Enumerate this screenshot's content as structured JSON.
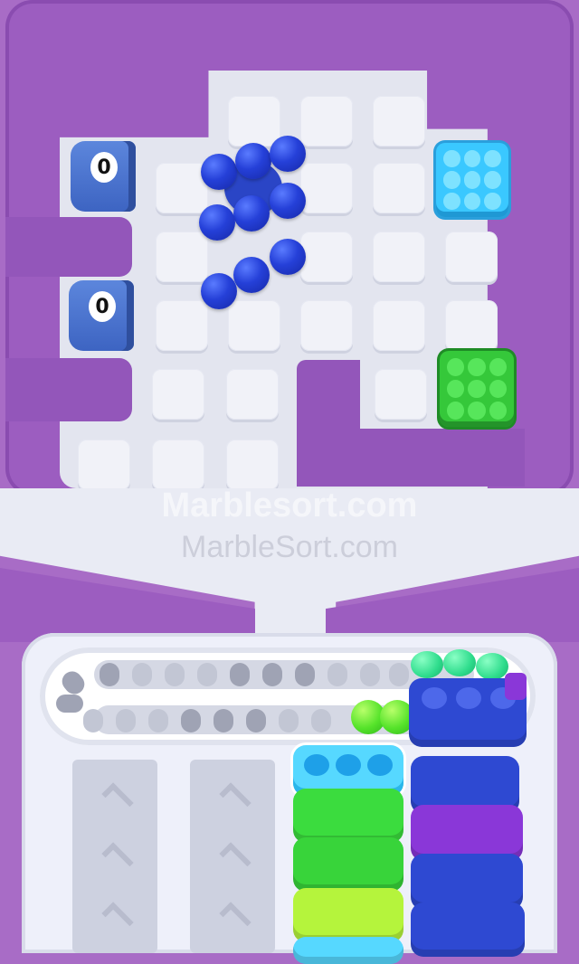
{
  "game": {
    "watermark_primary": "Marblesort.com",
    "watermark_secondary": "MarbleSort.com",
    "cannons": [
      {
        "count": "0",
        "color": "#4a72d0"
      },
      {
        "count": "0",
        "color": "#4a72d0"
      }
    ],
    "crates": [
      {
        "color": "cyan",
        "marbles": 9
      },
      {
        "color": "green",
        "marbles": 9
      }
    ],
    "bins_left": [
      "cyan",
      "green",
      "green",
      "lime",
      "cyan"
    ],
    "bins_right": [
      "blue",
      "blue",
      "purple",
      "blue",
      "blue"
    ],
    "colors": {
      "background": "#a86cc6",
      "marble_blue": "#2540d8",
      "crate_cyan": "#3ac8ff",
      "crate_green": "#35c83a"
    }
  }
}
